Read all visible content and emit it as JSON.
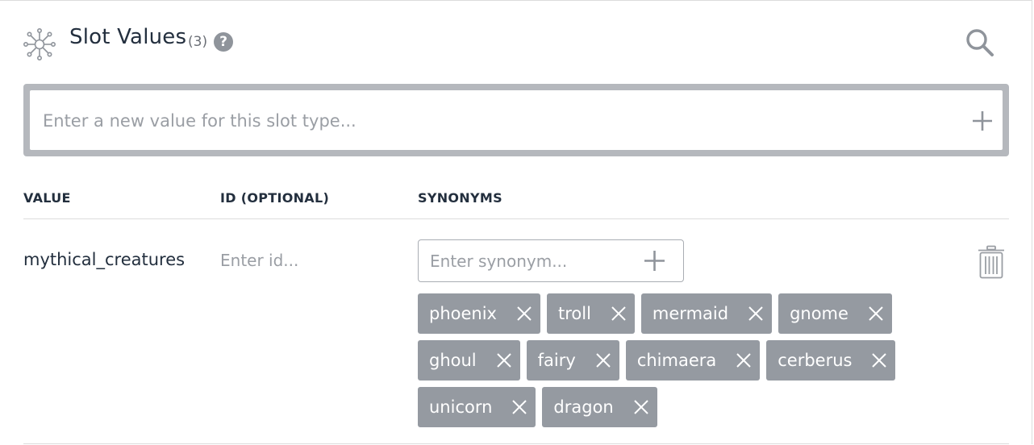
{
  "header": {
    "title": "Slot Values",
    "count": "(3)",
    "help": "?",
    "icon": "network-nodes-icon",
    "search_icon": "search-icon"
  },
  "new_value": {
    "placeholder": "Enter a new value for this slot type...",
    "add_icon": "plus-icon"
  },
  "columns": {
    "value": "VALUE",
    "id": "ID (OPTIONAL)",
    "synonyms": "SYNONYMS"
  },
  "row": {
    "value": "mythical_creatures",
    "id_placeholder": "Enter id...",
    "synonym_placeholder": "Enter synonym...",
    "delete_icon": "trash-icon",
    "synonyms": [
      [
        "phoenix",
        "troll",
        "mermaid",
        "gnome"
      ],
      [
        "ghoul",
        "fairy",
        "chimaera",
        "cerberus"
      ],
      [
        "unicorn",
        "dragon"
      ]
    ]
  },
  "colors": {
    "text": "#232f3e",
    "chip_bg": "#959aa1",
    "border": "#b5b8bd",
    "placeholder": "#9a9ea4"
  }
}
